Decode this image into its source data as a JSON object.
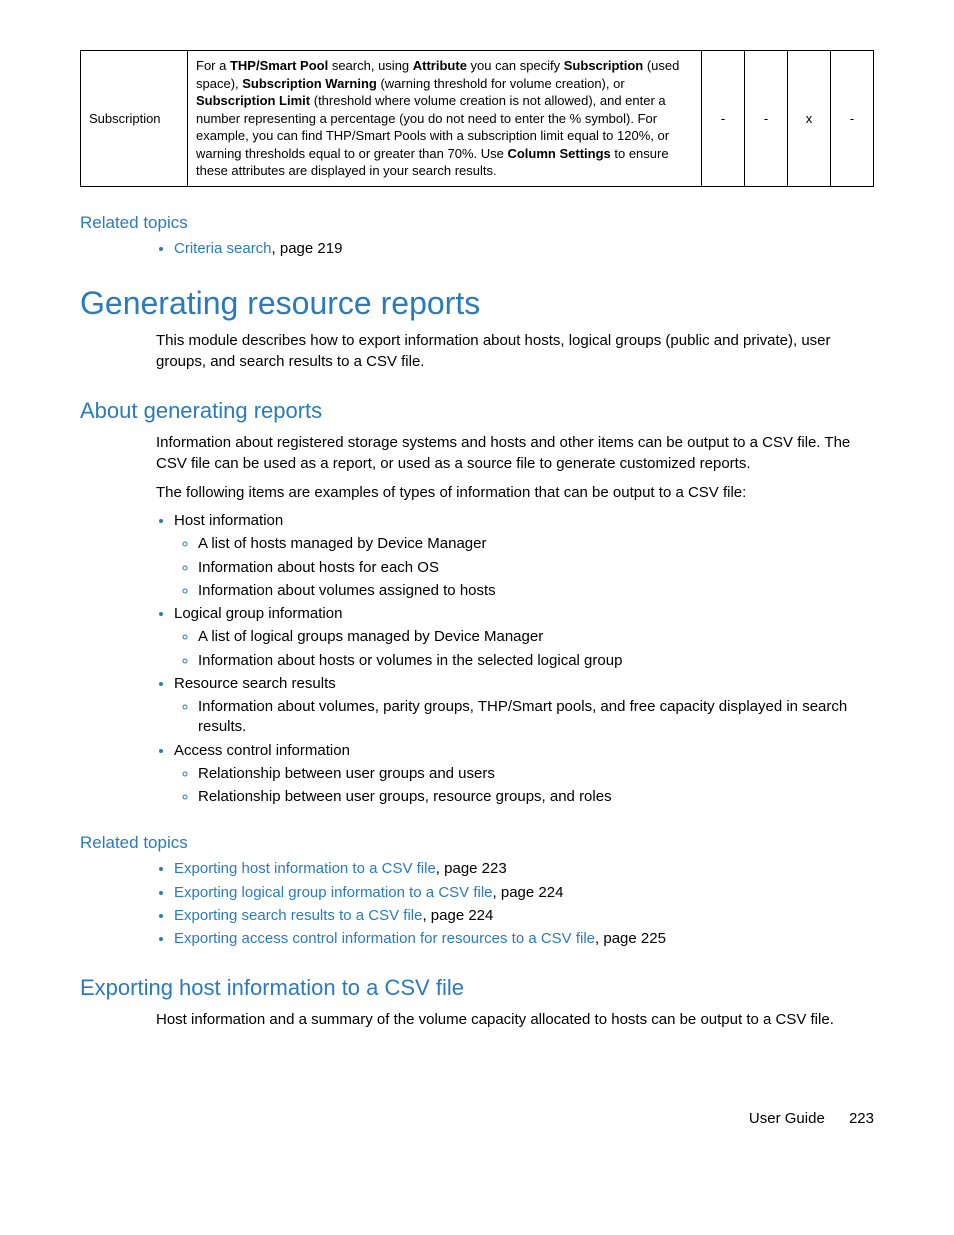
{
  "table": {
    "row": {
      "col0": "Subscription",
      "desc_parts": {
        "t1": "For a ",
        "b1": "THP/Smart Pool",
        "t2": " search, using ",
        "b2": "Attribute",
        "t3": " you can specify ",
        "b3": "Subscription",
        "t4": " (used space), ",
        "b4": "Subscription Warning",
        "t5": " (warning threshold for volume creation), or ",
        "b5": "Subscription Limit",
        "t6": " (threshold where volume creation is not allowed), and enter a number representing a percentage (you do not need to enter the % symbol). For example, you can find THP/Smart Pools with a subscription limit equal to 120%, or warning thresholds equal to or greater than 70%. Use ",
        "b6": "Column Settings",
        "t7": " to ensure these attributes are displayed in your search results."
      },
      "c1": "-",
      "c2": "-",
      "c3": "x",
      "c4": "-"
    }
  },
  "related1": {
    "heading": "Related topics",
    "item": {
      "link": "Criteria search",
      "rest": ", page 219"
    }
  },
  "main": {
    "heading": "Generating resource reports",
    "intro": "This module describes how to export information about hosts, logical groups (public and private), user groups, and search results to a CSV file."
  },
  "about": {
    "heading": "About generating reports",
    "p1": "Information about registered storage systems and hosts and other items can be output to a CSV file. The CSV file can be used as a report, or used as a source file to generate customized reports.",
    "p2": "The following items are examples of types of information that can be output to a CSV file:",
    "list": {
      "i0": {
        "label": "Host information",
        "sub": [
          "A list of hosts managed by Device Manager",
          "Information about hosts for each OS",
          "Information about volumes assigned to hosts"
        ]
      },
      "i1": {
        "label": "Logical group information",
        "sub": [
          "A list of logical groups managed by Device Manager",
          "Information about hosts or volumes in the selected logical group"
        ]
      },
      "i2": {
        "label": "Resource search results",
        "sub": [
          "Information about volumes, parity groups, THP/Smart pools, and free capacity displayed in search results."
        ]
      },
      "i3": {
        "label": "Access control information",
        "sub": [
          "Relationship between user groups and users",
          "Relationship between user groups, resource groups, and roles"
        ]
      }
    }
  },
  "related2": {
    "heading": "Related topics",
    "items": [
      {
        "link": "Exporting host information to a CSV file",
        "rest": ", page 223"
      },
      {
        "link": "Exporting logical group information to a CSV file",
        "rest": ", page 224"
      },
      {
        "link": "Exporting search results to a CSV file",
        "rest": ", page 224"
      },
      {
        "link": "Exporting access control information for resources to a CSV file",
        "rest": ", page 225"
      }
    ]
  },
  "export": {
    "heading": "Exporting host information to a CSV file",
    "p1": "Host information and a summary of the volume capacity allocated to hosts can be output to a CSV file."
  },
  "footer": {
    "label": "User Guide",
    "page": "223"
  }
}
